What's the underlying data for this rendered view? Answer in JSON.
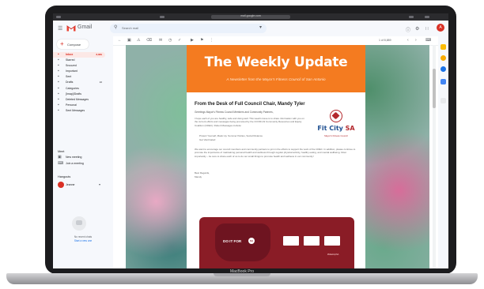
{
  "device": {
    "label": "MacBook Pro"
  },
  "browser": {
    "address": "mail.google.com"
  },
  "gmail": {
    "brand": "Gmail",
    "search_placeholder": "Search mail",
    "compose_label": "Compose",
    "nav": [
      {
        "label": "Inbox",
        "count": "8,889",
        "icon": "inbox-icon"
      },
      {
        "label": "Starred",
        "count": "",
        "icon": "star-icon"
      },
      {
        "label": "Snoozed",
        "count": "",
        "icon": "clock-icon"
      },
      {
        "label": "Important",
        "count": "",
        "icon": "label-important-icon"
      },
      {
        "label": "Sent",
        "count": "",
        "icon": "send-icon"
      },
      {
        "label": "Drafts",
        "count": "10",
        "icon": "draft-icon"
      },
      {
        "label": "Categories",
        "count": "",
        "icon": "category-icon"
      },
      {
        "label": "[Imap]/Drafts",
        "count": "",
        "icon": "label-icon"
      },
      {
        "label": "Deleted Messages",
        "count": "",
        "icon": "label-icon"
      },
      {
        "label": "Personal",
        "count": "",
        "icon": "label-icon"
      },
      {
        "label": "Sent Messages",
        "count": "",
        "icon": "label-icon"
      }
    ],
    "meet_heading": "Meet",
    "meet": [
      "New meeting",
      "Join a meeting"
    ],
    "hangouts_heading": "Hangouts",
    "hangouts_user": "Jeanne",
    "chat_text_1": "No recent chats",
    "chat_text_2": "Start a new one",
    "pager": "1 of 8,889",
    "accent": "#d93025"
  },
  "newsletter": {
    "title": "The Weekly Update",
    "subtitle": "A Newsletter from the Mayor's Fitness Council of San Antonio",
    "heading": "From the Desk of Full Council Chair, Mandy Tyler",
    "greeting": "Greetings Mayor's Fitness Council Members and Community Partners,",
    "para1": "I hope each of you are healthy, safe and doing well. This week's issue is to share information with you on the current efforts and messages being promoted by the COVID-19 Community Resources and Equity Coalition (CREC). Robert Messages include:",
    "bullets": [
      "Protect Yourself, Mask Up, Summer Parties, Social Distance",
      "Get Vaccinated"
    ],
    "para2": "We want to encourage our council members and community partners to join in the efforts to support the work of the CREC. In addition, please continue to promote the importance of maintaining personal health and wellness through regular physical activity, healthy eating, and mental wellbeing. Most importantly – be sure to share each of us to do our small things to promote health and wellness in our community!",
    "sign1": "Best Regards,",
    "sign2": "Mandy",
    "logo_text": "Fit City",
    "logo_sa": "SA",
    "logo_sub": "Mayor's Fitness Council",
    "banner_text": "DO IT FOR",
    "banner_badge": "SA",
    "banner_small": "#MaskUpSA",
    "accent": "#f47b20"
  }
}
